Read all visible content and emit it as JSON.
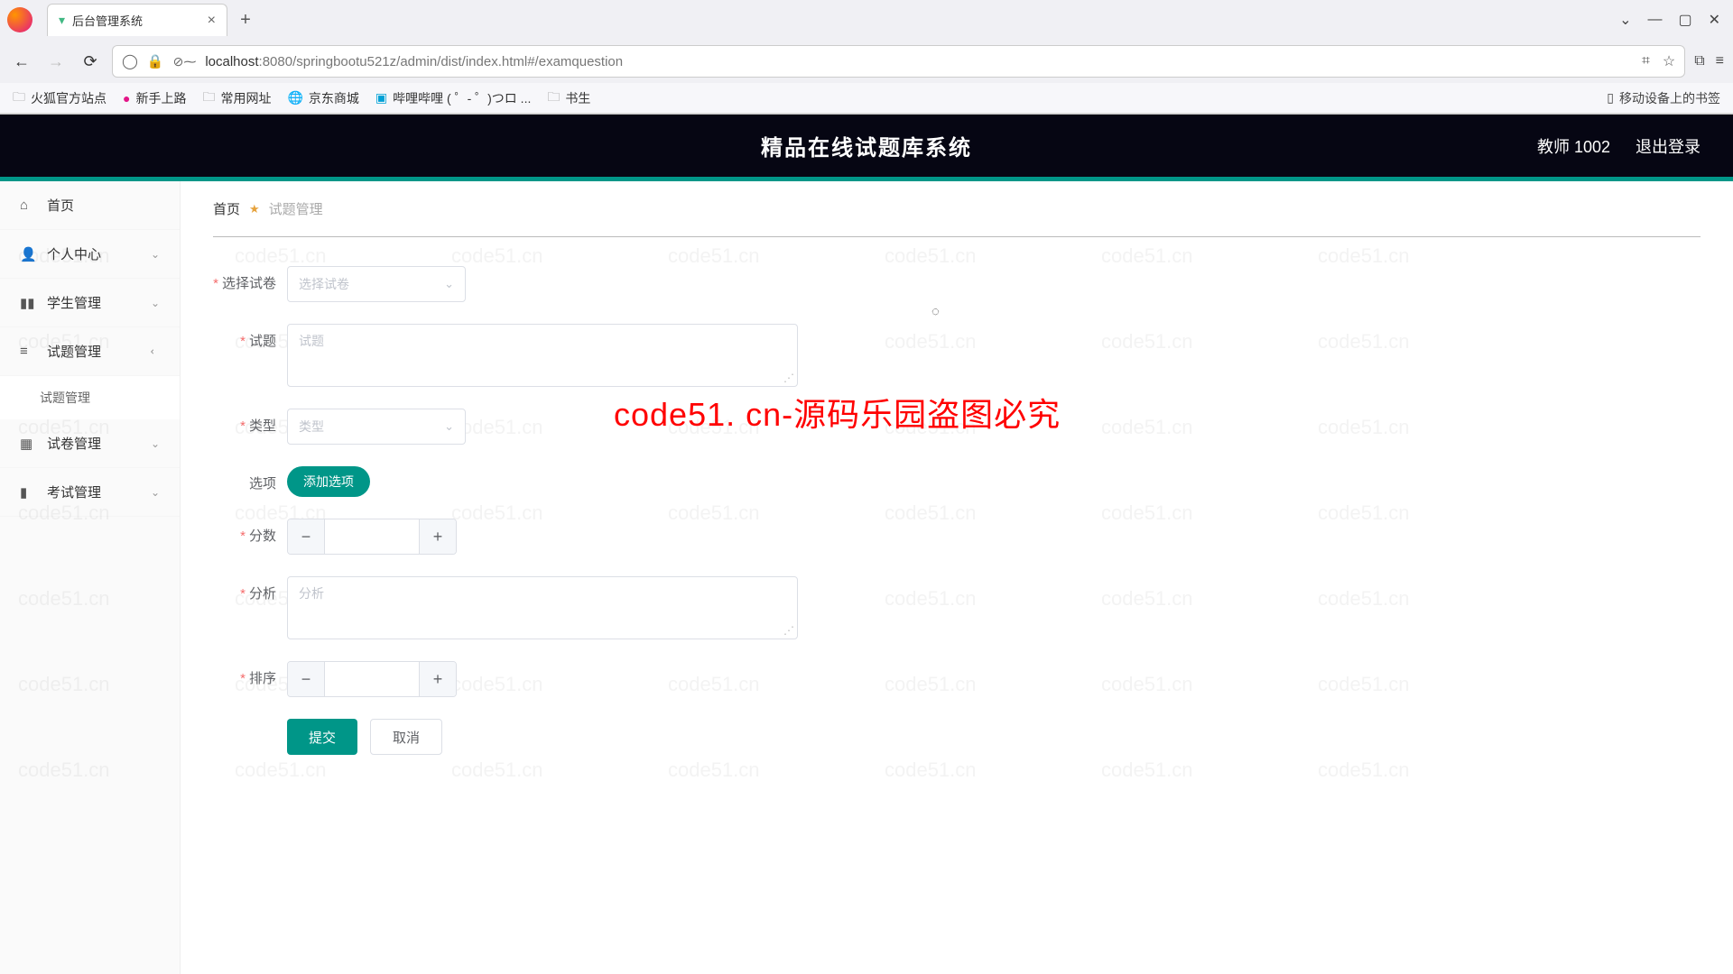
{
  "browser": {
    "tab_title": "后台管理系统",
    "url_domain": "localhost",
    "url_port_path": ":8080/springbootu521z/admin/dist/index.html#/examquestion",
    "bookmarks": {
      "b1": "火狐官方站点",
      "b2": "新手上路",
      "b3": "常用网址",
      "b4": "京东商城",
      "b5": "哔哩哔哩 ( ゜- ゜)つロ ...",
      "b6": "书生",
      "mobile": "移动设备上的书签"
    }
  },
  "app": {
    "title": "精品在线试题库系统",
    "user": "教师 1002",
    "logout": "退出登录"
  },
  "sidebar": {
    "home": "首页",
    "profile": "个人中心",
    "student": "学生管理",
    "question": "试题管理",
    "question_sub": "试题管理",
    "paper": "试卷管理",
    "exam": "考试管理"
  },
  "breadcrumb": {
    "home": "首页",
    "current": "试题管理"
  },
  "form": {
    "select_paper_label": "选择试卷",
    "select_paper_ph": "选择试卷",
    "question_label": "试题",
    "question_ph": "试题",
    "type_label": "类型",
    "type_ph": "类型",
    "option_label": "选项",
    "add_option": "添加选项",
    "score_label": "分数",
    "analysis_label": "分析",
    "analysis_ph": "分析",
    "sort_label": "排序",
    "submit": "提交",
    "cancel": "取消"
  },
  "watermark": {
    "text": "code51.cn",
    "big": "code51. cn-源码乐园盗图必究"
  }
}
